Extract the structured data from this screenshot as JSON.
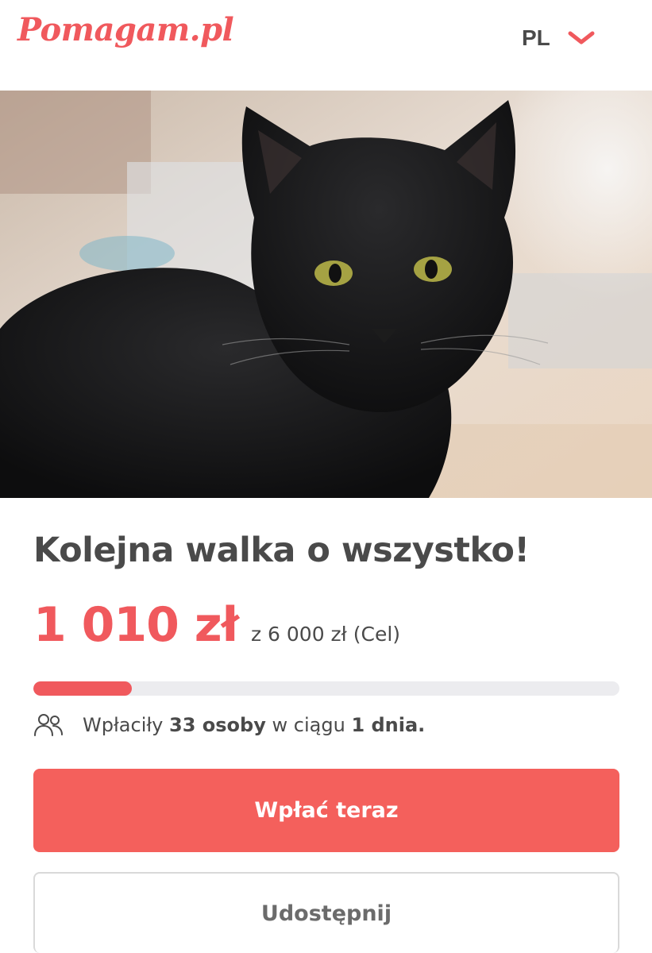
{
  "header": {
    "logo_text": "Pomagam.pl",
    "language": "PL",
    "language_icon": "chevron-down-icon"
  },
  "campaign": {
    "title": "Kolejna walka o wszystko!",
    "raised": "1 010 zł",
    "goal_text": "z 6 000 zł (Cel)",
    "progress_fraction": 0.168,
    "donors": {
      "icon": "people-icon",
      "prefix": "Wpłaciły",
      "count": "33 osoby",
      "middle": "w ciągu",
      "period": "1 dnia."
    }
  },
  "actions": {
    "donate_label": "Wpłać teraz",
    "share_label": "Udostępnij"
  },
  "colors": {
    "accent": "#f0595d",
    "button": "#f4605c",
    "text": "#4a4a4a",
    "track": "#ececef"
  }
}
